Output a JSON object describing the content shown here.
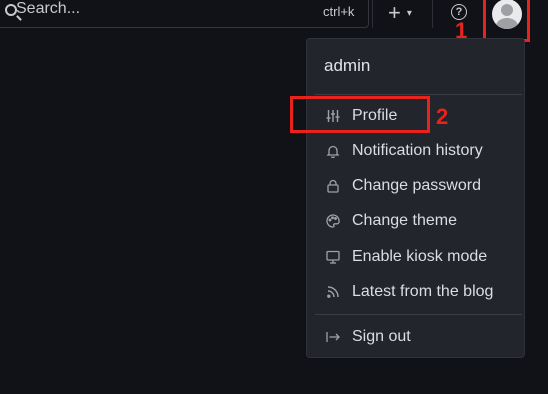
{
  "topbar": {
    "search_placeholder": "Search...",
    "search_shortcut": "ctrl+k",
    "add_icon": "plus-icon",
    "help_icon": "help-circle-icon",
    "help_glyph": "?"
  },
  "user_menu": {
    "username": "admin",
    "items": [
      {
        "label": "Profile",
        "icon": "sliders-icon"
      },
      {
        "label": "Notification history",
        "icon": "bell-icon"
      },
      {
        "label": "Change password",
        "icon": "lock-icon"
      },
      {
        "label": "Change theme",
        "icon": "palette-icon"
      },
      {
        "label": "Enable kiosk mode",
        "icon": "monitor-icon"
      },
      {
        "label": "Latest from the blog",
        "icon": "rss-icon"
      },
      {
        "label": "Sign out",
        "icon": "sign-out-icon"
      }
    ]
  },
  "annotations": [
    {
      "label": "1",
      "color": "#e8221d"
    },
    {
      "label": "2",
      "color": "#e8221d"
    }
  ]
}
